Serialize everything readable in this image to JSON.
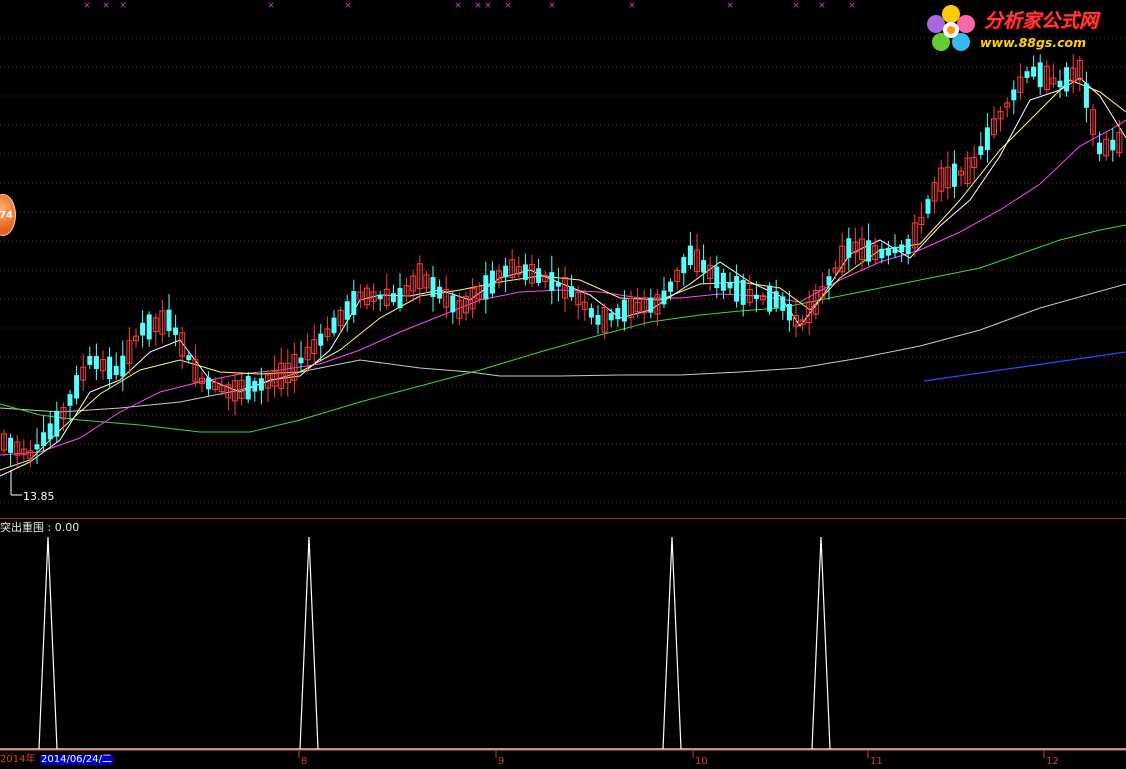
{
  "watermark": {
    "brand_cn": "分析家公式网",
    "url": "www.88gs.com",
    "flower_icon": "flower-logo-icon"
  },
  "badge": {
    "text": "74"
  },
  "price_panel": {
    "low_marker": "13.85",
    "colors": {
      "up": "#ff3c3c",
      "down": "#54ffff",
      "ma5": "#ffffff",
      "ma10": "#ffff66",
      "ma20": "#ff44ff",
      "ma30": "#33dd33",
      "ma60": "#c8c8c8",
      "ma120": "#3344ff",
      "grid": "#8b1a1a",
      "signal_mark": "#cc44cc"
    }
  },
  "indicator": {
    "label": "突出重围 : 0.00",
    "peaks": [
      1,
      1,
      1,
      1
    ],
    "baseline": 0
  },
  "time_axis": {
    "year_label": "2014年",
    "selected_date": "2014/06/24/二",
    "month_ticks": [
      "8",
      "9",
      "10",
      "11",
      "12"
    ]
  }
}
